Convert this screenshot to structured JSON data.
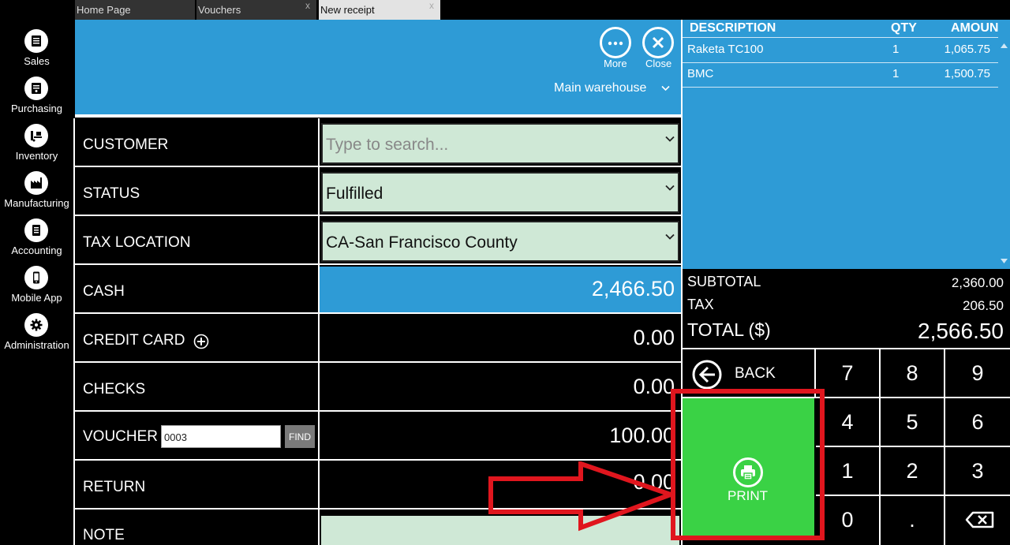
{
  "tabs": [
    {
      "label": "Home Page"
    },
    {
      "label": "Vouchers",
      "close": "x"
    },
    {
      "label": "New receipt",
      "close": "x"
    }
  ],
  "sidebar": {
    "items": [
      {
        "label": "Sales",
        "icon": "sales-icon"
      },
      {
        "label": "Purchasing",
        "icon": "purchasing-icon"
      },
      {
        "label": "Inventory",
        "icon": "inventory-icon"
      },
      {
        "label": "Manufacturing",
        "icon": "manufacturing-icon"
      },
      {
        "label": "Accounting",
        "icon": "accounting-icon"
      },
      {
        "label": "Mobile App",
        "icon": "mobile-icon"
      },
      {
        "label": "Administration",
        "icon": "gear-icon"
      }
    ]
  },
  "header": {
    "more_label": "More",
    "close_label": "Close",
    "warehouse": "Main warehouse"
  },
  "form": {
    "customer": {
      "label": "CUSTOMER",
      "placeholder": "Type to search..."
    },
    "status": {
      "label": "STATUS",
      "value": "Fulfilled"
    },
    "tax_location": {
      "label": "TAX LOCATION",
      "value": "CA-San Francisco County"
    },
    "cash": {
      "label": "CASH",
      "value": "2,466.50"
    },
    "credit_card": {
      "label": "CREDIT CARD",
      "value": "0.00"
    },
    "checks": {
      "label": "CHECKS",
      "value": "0.00"
    },
    "voucher": {
      "label": "VOUCHER",
      "input_value": "0003",
      "find_label": "FIND",
      "value": "100.00"
    },
    "return": {
      "label": "RETURN",
      "value": "0.00"
    },
    "note": {
      "label": "NOTE"
    }
  },
  "items_table": {
    "columns": [
      "DESCRIPTION",
      "QTY",
      "AMOUNT"
    ],
    "rows": [
      {
        "description": "Raketa TC100",
        "qty": "1",
        "amount": "1,065.75"
      },
      {
        "description": "BMC",
        "qty": "1",
        "amount": "1,500.75"
      }
    ]
  },
  "totals": {
    "subtotal_label": "SUBTOTAL",
    "subtotal": "2,360.00",
    "tax_label": "TAX",
    "tax": "206.50",
    "total_label": "TOTAL ($)",
    "total": "2,566.50"
  },
  "keypad": {
    "back_label": "BACK",
    "print_label": "PRINT",
    "keys": [
      "7",
      "8",
      "9",
      "4",
      "5",
      "6",
      "1",
      "2",
      "3",
      "0",
      "."
    ]
  },
  "colors": {
    "accent": "#2e9bd6",
    "print": "#3ad245",
    "highlight": "#e0161e",
    "field": "#cfe8d6"
  }
}
